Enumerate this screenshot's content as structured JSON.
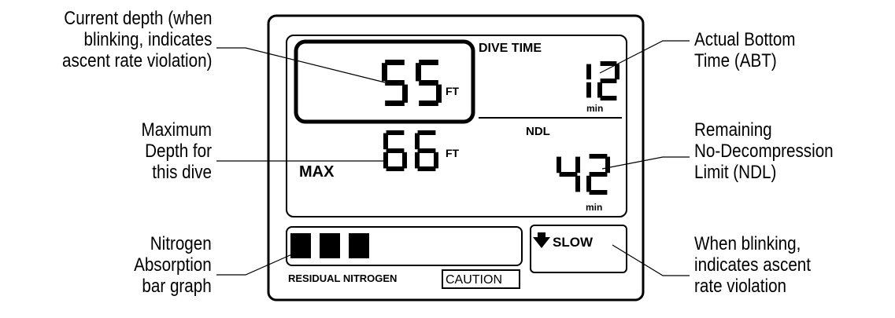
{
  "display": {
    "current_depth": "55",
    "max_depth": "66",
    "depth_unit": "FT",
    "dive_time_label": "DIVE TIME",
    "dive_time_value": "12",
    "time_unit": "min",
    "ndl_label": "NDL",
    "ndl_value": "42",
    "max_label": "MAX",
    "nitrogen_label": "RESIDUAL NITROGEN",
    "caution_label": "CAUTION",
    "slow_label": "SLOW",
    "nitrogen_bars_lit": 3
  },
  "callouts": {
    "current_depth": [
      "Current depth (when",
      "blinking, indicates",
      "ascent rate violation)"
    ],
    "max_depth": [
      "Maximum",
      "Depth for",
      "this dive"
    ],
    "nitrogen": [
      "Nitrogen",
      "Absorption",
      "bar graph"
    ],
    "abt": [
      "Actual Bottom",
      "Time (ABT)"
    ],
    "ndl": [
      "Remaining",
      "No-Decompression",
      "Limit (NDL)"
    ],
    "slow": [
      "When blinking,",
      "indicates ascent",
      "rate violation"
    ]
  }
}
